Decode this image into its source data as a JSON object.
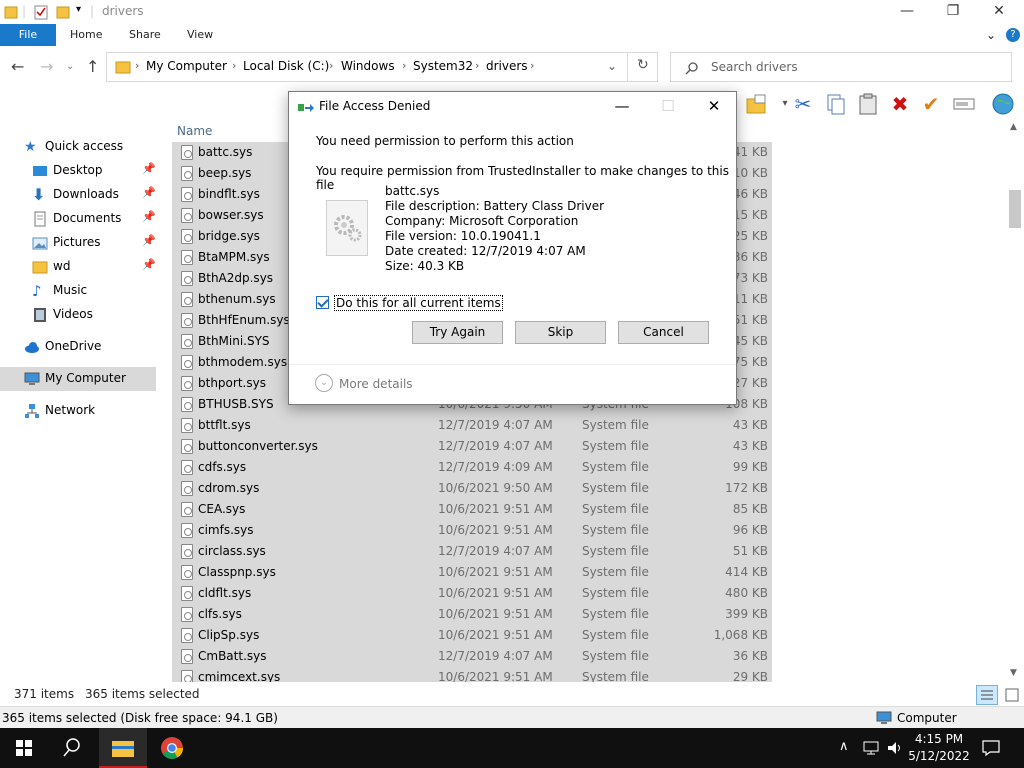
{
  "window": {
    "title": "drivers",
    "minimize_glyph": "—",
    "maximize_glyph": "❐",
    "close_glyph": "✕",
    "help_glyph": "?",
    "collapse_glyph": "⌄"
  },
  "ribbon": {
    "file": "File",
    "tabs": [
      "Home",
      "Share",
      "View"
    ]
  },
  "address": {
    "crumbs": [
      "My Computer",
      "Local Disk (C:)",
      "Windows",
      "System32",
      "drivers"
    ],
    "search_placeholder": "Search drivers"
  },
  "sidebar": {
    "items": [
      {
        "label": "Quick access",
        "icon": "star-icon",
        "pinned": false
      },
      {
        "label": "Desktop",
        "icon": "desktop-icon",
        "pinned": true
      },
      {
        "label": "Downloads",
        "icon": "download-icon",
        "pinned": true
      },
      {
        "label": "Documents",
        "icon": "documents-icon",
        "pinned": true
      },
      {
        "label": "Pictures",
        "icon": "pictures-icon",
        "pinned": true
      },
      {
        "label": "wd",
        "icon": "folder-icon",
        "pinned": true
      },
      {
        "label": "Music",
        "icon": "music-icon",
        "pinned": false
      },
      {
        "label": "Videos",
        "icon": "videos-icon",
        "pinned": false
      },
      {
        "label": "OneDrive",
        "icon": "cloud-icon",
        "pinned": false
      },
      {
        "label": "My Computer",
        "icon": "computer-icon",
        "pinned": false
      },
      {
        "label": "Network",
        "icon": "network-icon",
        "pinned": false
      }
    ]
  },
  "filelist": {
    "column_name": "Name",
    "rows": [
      {
        "name": "battc.sys",
        "date": "",
        "type": "",
        "size": "41 KB"
      },
      {
        "name": "beep.sys",
        "date": "",
        "type": "",
        "size": "10 KB"
      },
      {
        "name": "bindflt.sys",
        "date": "",
        "type": "",
        "size": "46 KB"
      },
      {
        "name": "bowser.sys",
        "date": "",
        "type": "",
        "size": "15 KB"
      },
      {
        "name": "bridge.sys",
        "date": "",
        "type": "",
        "size": "25 KB"
      },
      {
        "name": "BtaMPM.sys",
        "date": "",
        "type": "",
        "size": "36 KB"
      },
      {
        "name": "BthA2dp.sys",
        "date": "",
        "type": "",
        "size": "273 KB"
      },
      {
        "name": "bthenum.sys",
        "date": "",
        "type": "",
        "size": "11 KB"
      },
      {
        "name": "BthHfEnum.sys",
        "date": "",
        "type": "",
        "size": "51 KB"
      },
      {
        "name": "BthMini.SYS",
        "date": "",
        "type": "",
        "size": "45 KB"
      },
      {
        "name": "bthmodem.sys",
        "date": "",
        "type": "",
        "size": "75 KB"
      },
      {
        "name": "bthport.sys",
        "date": "",
        "type": "",
        "size": "627 KB"
      },
      {
        "name": "BTHUSB.SYS",
        "date": "10/6/2021 9:50 AM",
        "type": "System file",
        "size": "108 KB"
      },
      {
        "name": "bttflt.sys",
        "date": "12/7/2019 4:07 AM",
        "type": "System file",
        "size": "43 KB"
      },
      {
        "name": "buttonconverter.sys",
        "date": "12/7/2019 4:07 AM",
        "type": "System file",
        "size": "43 KB"
      },
      {
        "name": "cdfs.sys",
        "date": "12/7/2019 4:09 AM",
        "type": "System file",
        "size": "99 KB"
      },
      {
        "name": "cdrom.sys",
        "date": "10/6/2021 9:50 AM",
        "type": "System file",
        "size": "172 KB"
      },
      {
        "name": "CEA.sys",
        "date": "10/6/2021 9:51 AM",
        "type": "System file",
        "size": "85 KB"
      },
      {
        "name": "cimfs.sys",
        "date": "10/6/2021 9:51 AM",
        "type": "System file",
        "size": "96 KB"
      },
      {
        "name": "circlass.sys",
        "date": "12/7/2019 4:07 AM",
        "type": "System file",
        "size": "51 KB"
      },
      {
        "name": "Classpnp.sys",
        "date": "10/6/2021 9:51 AM",
        "type": "System file",
        "size": "414 KB"
      },
      {
        "name": "cldflt.sys",
        "date": "10/6/2021 9:51 AM",
        "type": "System file",
        "size": "480 KB"
      },
      {
        "name": "clfs.sys",
        "date": "10/6/2021 9:51 AM",
        "type": "System file",
        "size": "399 KB"
      },
      {
        "name": "ClipSp.sys",
        "date": "10/6/2021 9:51 AM",
        "type": "System file",
        "size": "1,068 KB"
      },
      {
        "name": "CmBatt.sys",
        "date": "12/7/2019 4:07 AM",
        "type": "System file",
        "size": "36 KB"
      },
      {
        "name": "cmimcext.sys",
        "date": "10/6/2021 9:51 AM",
        "type": "System file",
        "size": "29 KB"
      }
    ]
  },
  "status": {
    "items_count": "371 items",
    "items_selected": "365 items selected",
    "bottom_left": "365 items selected (Disk free space: 94.1 GB)",
    "bottom_right": "Computer"
  },
  "taskbar": {
    "time": "4:15 PM",
    "date": "5/12/2022"
  },
  "dialog": {
    "title": "File Access Denied",
    "message": "You need permission to perform this action",
    "permission": "You require permission from TrustedInstaller to make changes to this file",
    "file_name": "battc.sys",
    "description": "File description: Battery Class Driver",
    "company": "Company: Microsoft Corporation",
    "version": "File version: 10.0.19041.1",
    "created": "Date created: 12/7/2019 4:07 AM",
    "size": "Size: 40.3 KB",
    "checkbox_label": "Do this for all current items",
    "checkbox_checked": true,
    "buttons": {
      "try_again": "Try Again",
      "skip": "Skip",
      "cancel": "Cancel"
    },
    "more_details": "More details"
  },
  "colors": {
    "file_tab": "#1979ca",
    "row_selected": "#cce8ff",
    "row_highlight": "#d9d9d9",
    "taskbar": "#101010"
  }
}
